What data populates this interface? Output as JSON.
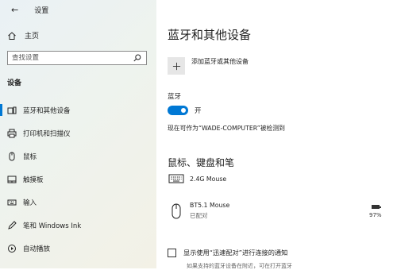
{
  "window": {
    "title": "设置"
  },
  "sidebar": {
    "home_label": "主页",
    "search_placeholder": "查找设置",
    "section_heading": "设备",
    "items": [
      {
        "label": "蓝牙和其他设备",
        "icon": "bluetooth-devices-icon",
        "active": true
      },
      {
        "label": "打印机和扫描仪",
        "icon": "printer-icon"
      },
      {
        "label": "鼠标",
        "icon": "mouse-icon"
      },
      {
        "label": "触摸板",
        "icon": "touchpad-icon"
      },
      {
        "label": "输入",
        "icon": "keyboard-icon"
      },
      {
        "label": "笔和 Windows Ink",
        "icon": "pen-icon"
      },
      {
        "label": "自动播放",
        "icon": "autoplay-icon"
      }
    ]
  },
  "main": {
    "title": "蓝牙和其他设备",
    "add_device_label": "添加蓝牙或其他设备",
    "bluetooth": {
      "label": "蓝牙",
      "toggle_state": "开",
      "on": true,
      "discoverable_text": "现在可作为“WADE-COMPUTER”被检测到"
    },
    "mouse_keyboard_pen": {
      "heading": "鼠标、键盘和笔",
      "devices": [
        {
          "name": "2.4G Mouse",
          "icon": "keyboard-icon"
        },
        {
          "name": "BT5.1 Mouse",
          "status": "已配对",
          "icon": "mouse-icon",
          "battery": "97%",
          "battery_level": 0.97
        }
      ]
    },
    "swift_pair": {
      "label": "显示使用“迅速配对”进行连接的通知",
      "sub": "如果支持的蓝牙设备在附近，可在打开蓝牙"
    }
  },
  "colors": {
    "accent": "#0078d4"
  }
}
